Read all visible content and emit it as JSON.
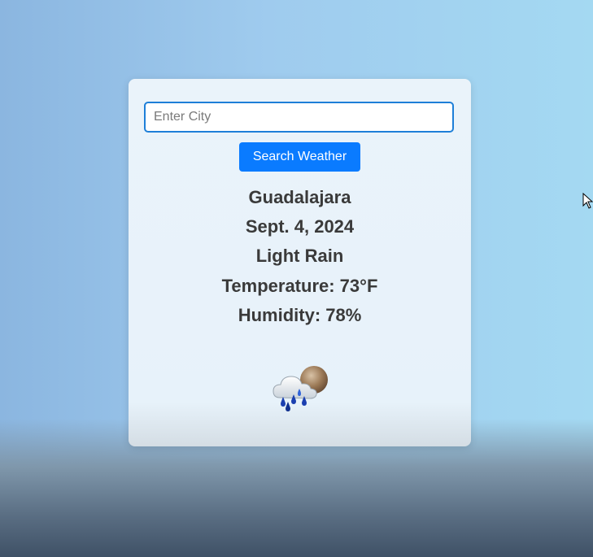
{
  "search": {
    "placeholder": "Enter City",
    "value": "",
    "button_label": "Search Weather"
  },
  "weather": {
    "city": "Guadalajara",
    "date": "Sept. 4, 2024",
    "condition": "Light Rain",
    "temperature": "Temperature: 73°F",
    "humidity": "Humidity: 78%",
    "icon": "rain-cloud-icon"
  },
  "colors": {
    "accent": "#0a7bff",
    "input_border": "#1e7fd8",
    "text": "#3a3a3a",
    "card": "#eaf3fa"
  }
}
